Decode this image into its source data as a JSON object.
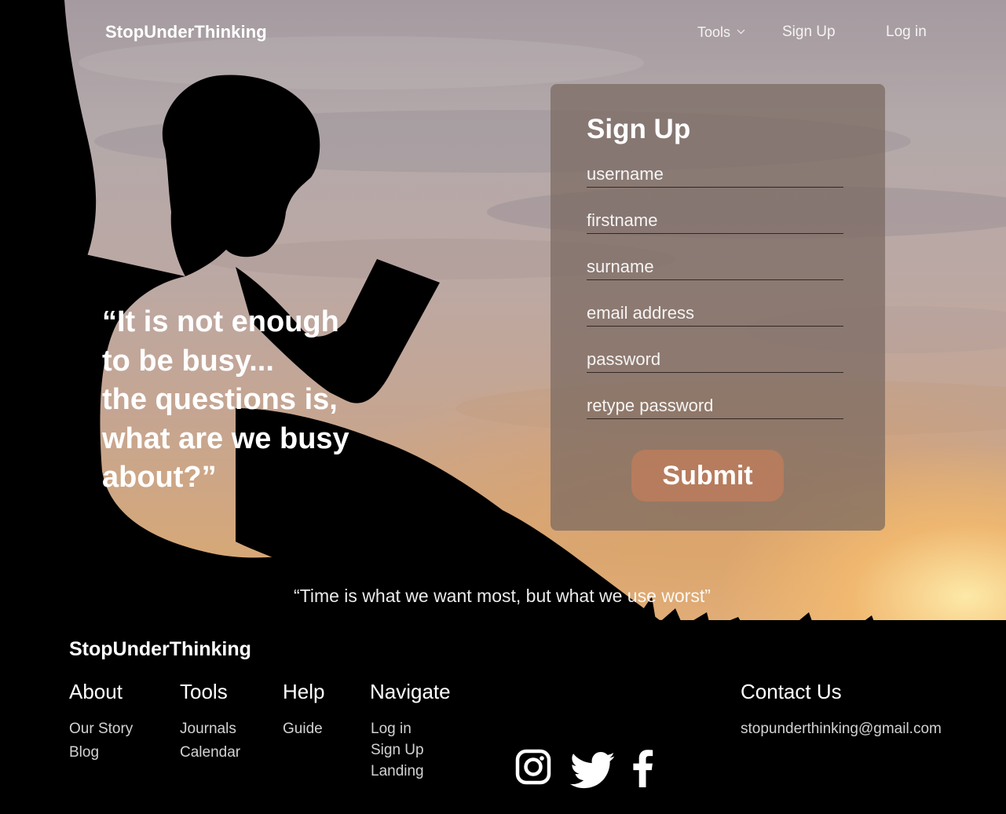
{
  "header": {
    "brand": "StopUnderThinking",
    "nav": {
      "tools": "Tools",
      "signup": "Sign Up",
      "login": "Log in"
    }
  },
  "hero": {
    "quote_lines": [
      "“It is not enough",
      "to be busy...",
      "the questions is,",
      "what are we busy",
      "about?”"
    ]
  },
  "signup_form": {
    "title": "Sign Up",
    "fields": {
      "username": "username",
      "firstname": "firstname",
      "surname": "surname",
      "email": "email address",
      "password": "password",
      "retype": "retype password"
    },
    "submit_label": "Submit"
  },
  "tagline": "“Time is what we want most, but what we use worst”",
  "footer": {
    "brand": "StopUnderThinking",
    "about": {
      "heading": "About",
      "links": [
        "Our Story",
        "Blog"
      ]
    },
    "tools": {
      "heading": "Tools",
      "links": [
        "Journals",
        "Calendar"
      ]
    },
    "help": {
      "heading": "Help",
      "links": [
        "Guide"
      ]
    },
    "navigate": {
      "heading": "Navigate",
      "links": [
        "Log in",
        "Sign Up",
        "Landing"
      ]
    },
    "contact": {
      "heading": "Contact Us",
      "email": "stopunderthinking@gmail.com"
    },
    "social_icons": [
      "instagram-icon",
      "twitter-icon",
      "facebook-icon"
    ]
  }
}
